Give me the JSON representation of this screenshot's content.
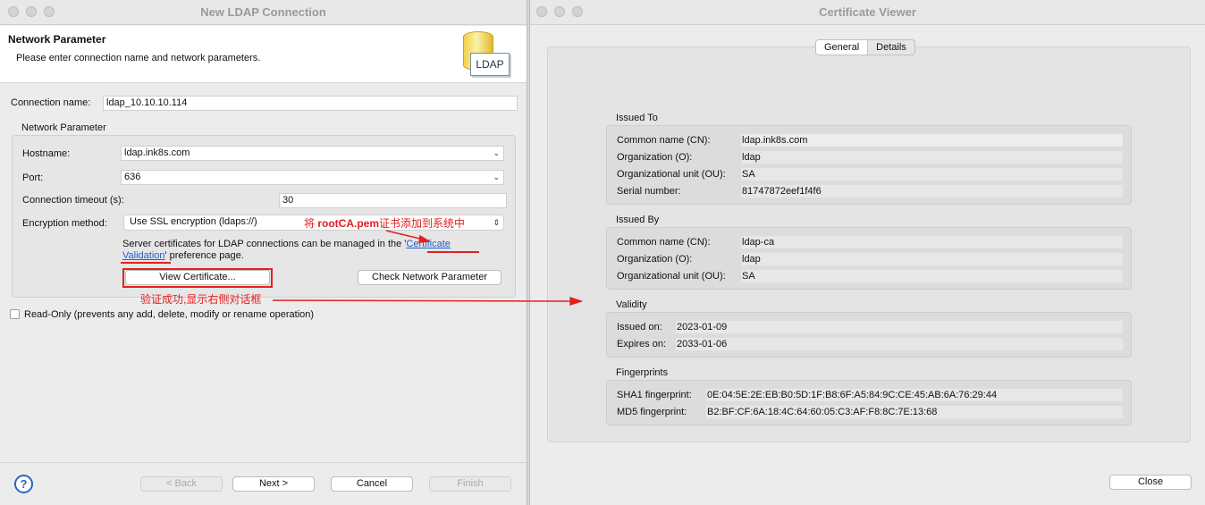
{
  "ldap_window": {
    "title": "New LDAP Connection",
    "header_title": "Network Parameter",
    "header_desc": "Please enter connection name and network parameters.",
    "logo_text": "LDAP",
    "connection_name_label": "Connection name:",
    "connection_name_value": "ldap_10.10.10.114",
    "group_title": "Network Parameter",
    "hostname_label": "Hostname:",
    "hostname_value": "ldap.ink8s.com",
    "port_label": "Port:",
    "port_value": "636",
    "timeout_label": "Connection timeout (s):",
    "timeout_value": "30",
    "encryption_label": "Encryption method:",
    "encryption_value": "Use SSL encryption (ldaps://)",
    "cert_text_pre": "Server certificates for LDAP connections can be managed in the '",
    "cert_link_1": "Certificate",
    "cert_link_2": "Validation",
    "cert_text_post": "' preference page.",
    "view_cert_button": "View Certificate...",
    "check_network_button": "Check Network Parameter",
    "readonly_label": "Read-Only (prevents any add, delete, modify or rename operation)",
    "back_button": "< Back",
    "next_button": "Next >",
    "cancel_button": "Cancel",
    "finish_button": "Finish",
    "help_symbol": "?"
  },
  "annotations": {
    "note1_pre": "将 ",
    "note1_bold": "rootCA.pem",
    "note1_post": "证书添加到系统中",
    "note2": "验证成功,显示右侧对话框",
    "color": "#e22020"
  },
  "cert_window": {
    "title": "Certificate Viewer",
    "tabs": [
      "General",
      "Details"
    ],
    "issued_to": {
      "title": "Issued To",
      "rows": [
        {
          "label": "Common name (CN):",
          "value": "ldap.ink8s.com"
        },
        {
          "label": "Organization (O):",
          "value": "ldap"
        },
        {
          "label": "Organizational unit (OU):",
          "value": "SA"
        },
        {
          "label": "Serial number:",
          "value": "81747872eef1f4f6"
        }
      ]
    },
    "issued_by": {
      "title": "Issued By",
      "rows": [
        {
          "label": "Common name (CN):",
          "value": "ldap-ca"
        },
        {
          "label": "Organization (O):",
          "value": "ldap"
        },
        {
          "label": "Organizational unit (OU):",
          "value": "SA"
        }
      ]
    },
    "validity": {
      "title": "Validity",
      "rows": [
        {
          "label": "Issued on:",
          "value": "2023-01-09"
        },
        {
          "label": "Expires on:",
          "value": "2033-01-06"
        }
      ]
    },
    "fingerprints": {
      "title": "Fingerprints",
      "rows": [
        {
          "label": "SHA1 fingerprint:",
          "value": "0E:04:5E:2E:EB:B0:5D:1F:B8:6F:A5:84:9C:CE:45:AB:6A:76:29:44"
        },
        {
          "label": "MD5 fingerprint:",
          "value": "B2:BF:CF:6A:18:4C:64:60:05:C3:AF:F8:8C:7E:13:68"
        }
      ]
    },
    "close_button": "Close"
  }
}
